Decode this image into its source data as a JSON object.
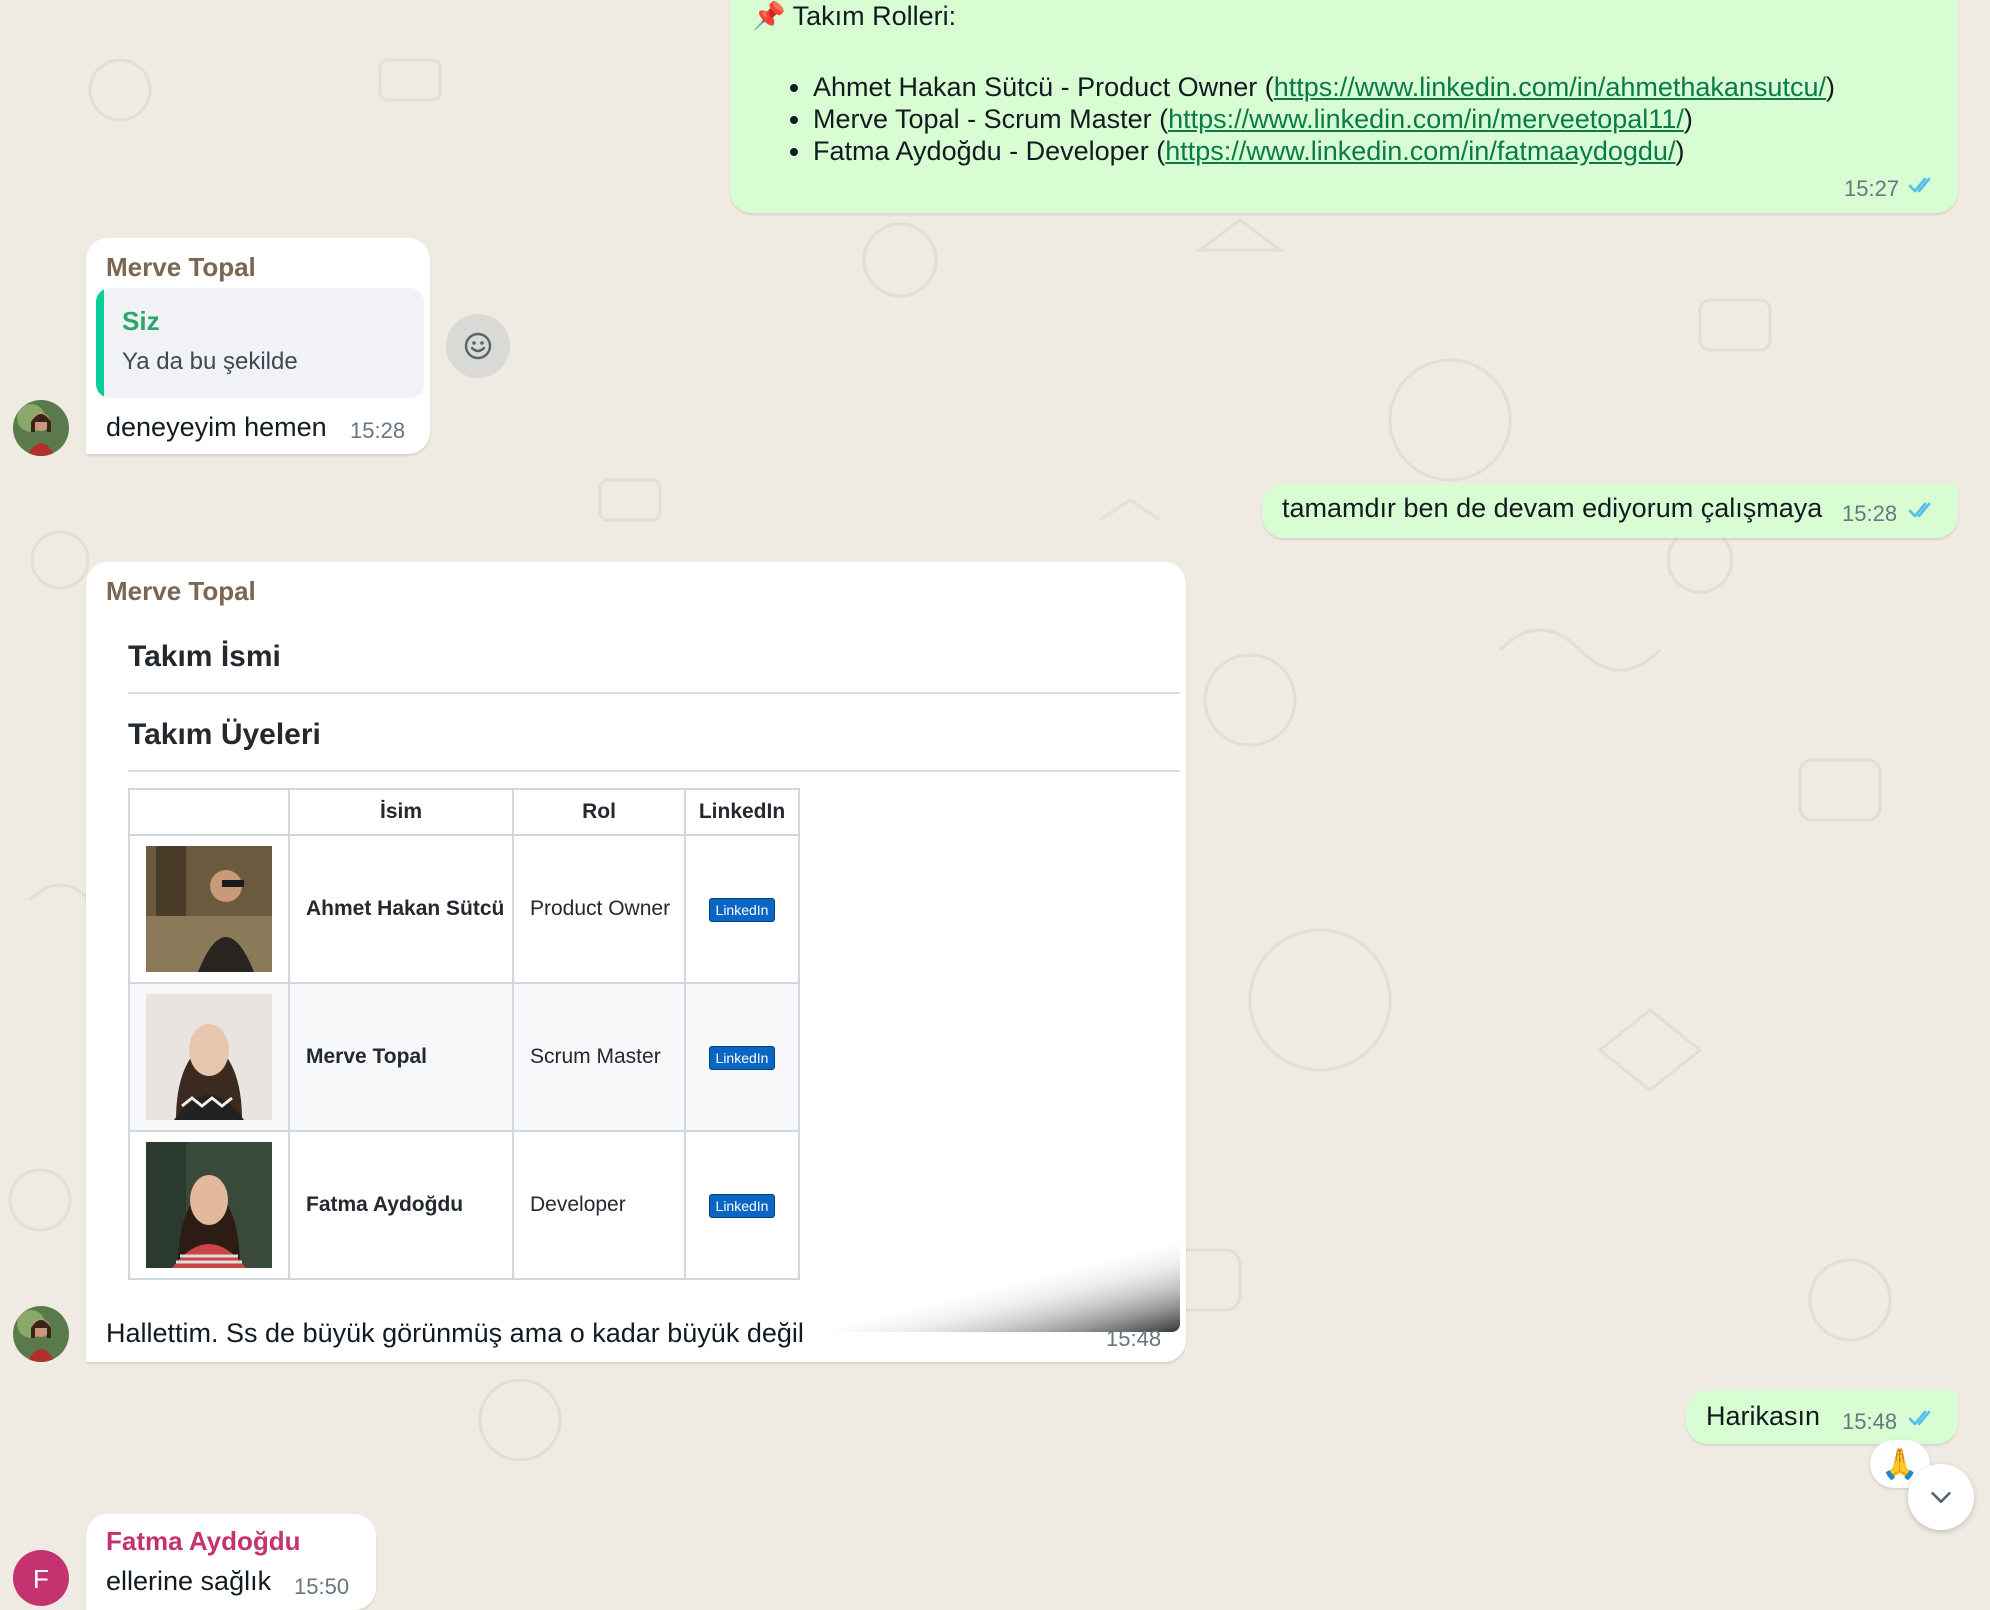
{
  "colors": {
    "outgoing_bubble": "#d9fdd3",
    "incoming_bubble": "#ffffff",
    "background": "#efeae2",
    "sender_merve": "#7a6651",
    "sender_fatma": "#c4326f",
    "reply_author": "#25a86a",
    "read_ticks": "#53bdeb"
  },
  "messages": {
    "roles": {
      "pin_emoji": "📌",
      "title": "Takım Rolleri:",
      "items": [
        {
          "name": "Ahmet Hakan Sütcü - Product Owner (",
          "url": "https://www.linkedin.com/in/ahmethakansutcu/",
          "close": ")"
        },
        {
          "name": "Merve Topal - Scrum Master (",
          "url": "https://www.linkedin.com/in/merveetopal11/",
          "close": ")"
        },
        {
          "name": "Fatma Aydoğdu - Developer (",
          "url": "https://www.linkedin.com/in/fatmaaydogdu/",
          "close": ")"
        }
      ],
      "time": "15:27"
    },
    "merve_reply": {
      "sender": "Merve Topal",
      "quote_author": "Siz",
      "quote_text": "Ya da bu şekilde",
      "text": "deneyeyim hemen",
      "time": "15:28"
    },
    "my_continue": {
      "text": "tamamdır ben de devam ediyorum çalışmaya",
      "time": "15:28"
    },
    "merve_image": {
      "sender": "Merve Topal",
      "caption": "Hallettim. Ss de büyük görünmüş ama o kadar büyük değil",
      "time": "15:48",
      "screenshot": {
        "heading1": "Takım İsmi",
        "heading2": "Takım Üyeleri",
        "headers": [
          "",
          "İsim",
          "Rol",
          "LinkedIn"
        ],
        "rows": [
          {
            "name": "Ahmet Hakan Sütcü",
            "role": "Product Owner",
            "badge": "LinkedIn"
          },
          {
            "name": "Merve Topal",
            "role": "Scrum Master",
            "badge": "LinkedIn"
          },
          {
            "name": "Fatma Aydoğdu",
            "role": "Developer",
            "badge": "LinkedIn"
          }
        ]
      }
    },
    "my_great": {
      "text": "Harikasın",
      "time": "15:48",
      "reaction": "🙏"
    },
    "fatma": {
      "sender": "Fatma Aydoğdu",
      "text": "ellerine sağlık",
      "time": "15:50",
      "avatar_letter": "F"
    }
  }
}
